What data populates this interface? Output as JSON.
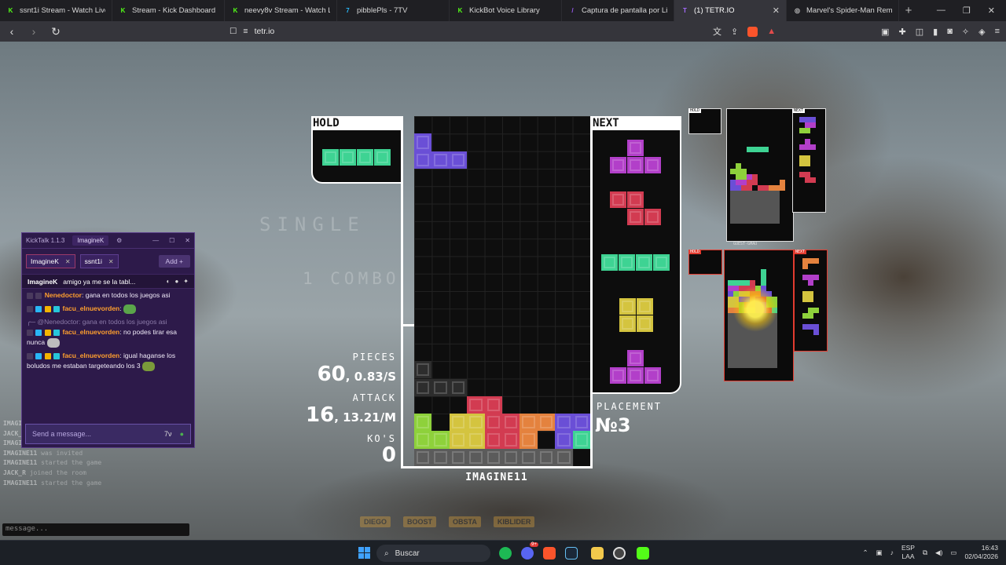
{
  "browser": {
    "tabs": [
      {
        "label": "ssnt1i Stream - Watch Live",
        "fav": "K",
        "color": "#53fc18",
        "active": false
      },
      {
        "label": "Stream - Kick Dashboard",
        "fav": "K",
        "color": "#53fc18",
        "active": false
      },
      {
        "label": "neevy8v Stream - Watch Li",
        "fav": "K",
        "color": "#53fc18",
        "active": false
      },
      {
        "label": "pibblePls - 7TV",
        "fav": "7",
        "color": "#29b6f6",
        "active": false
      },
      {
        "label": "KickBot Voice Library",
        "fav": "K",
        "color": "#53fc18",
        "active": false
      },
      {
        "label": "Captura de pantalla por Lightsh",
        "fav": "/",
        "color": "#9c5cf5",
        "active": false
      },
      {
        "label": "(1) TETR.IO",
        "fav": "T",
        "color": "#a56bff",
        "active": true
      },
      {
        "label": "Marvel's Spider-Man Remaster",
        "fav": "◎",
        "color": "#cccccc",
        "active": false
      }
    ],
    "url": "tetr.io",
    "window_controls": [
      "—",
      "❐",
      "✕"
    ]
  },
  "game": {
    "hold_label": "HOLD",
    "next_label": "NEXT",
    "ghost_clear_text": "SINGLE",
    "ghost_combo_text": "1 COMBO",
    "stats": {
      "pieces_label": "PIECES",
      "pieces_count": "60",
      "pieces_rate": ", 0.83/S",
      "attack_label": "ATTACK",
      "attack_count": "16",
      "attack_rate": ", 13.21/M",
      "kos_label": "KO'S",
      "kos_count": "0"
    },
    "placement_label": "PLACEMENT",
    "placement_value": "№3",
    "player_name": "IMAGINE11",
    "piece_colors": {
      "I": "#3ed393",
      "T": "#b23fc9",
      "Z": "#d23b51",
      "L": "#e4823e",
      "O": "#d4c43f",
      "S": "#8ed13b",
      "J": "#6a4fd6",
      "G": "#5b5b5b"
    },
    "opponent_hold_label": "HOLD",
    "opponent_next_label": "NEXT",
    "opponent2_name": "GUEST-GMAU"
  },
  "chat": {
    "app_title": "KickTalk 1.1.3",
    "user_tab": "ImagineK",
    "channel_tabs": [
      {
        "label": "ImagineK",
        "active": true
      },
      {
        "label": "ssnt1i",
        "active": false
      }
    ],
    "add_label": "Add",
    "pinned_user": "ImagineK",
    "pinned_text": "amigo ya me se la tabl...",
    "messages": [
      {
        "user": "Nenedoctor",
        "text": "gana en todos los juegos asi",
        "kind": "plain"
      },
      {
        "user": "facu_elnuevorden",
        "text": "",
        "kind": "emote"
      },
      {
        "quote": "@Nenedoctor: gana en todos los juegos asi",
        "user": "facu_elnuevorden",
        "text": "no podes tirar esa nunca",
        "kind": "reply"
      },
      {
        "user": "facu_elnuevorden",
        "text": "igual haganse los boludos me estaban targeteando los 3",
        "kind": "plain-badged"
      }
    ],
    "input_placeholder": "Send a message..."
  },
  "tetrio_chat_log": [
    {
      "user": "IMAGINE11",
      "text": "joined the room"
    },
    {
      "user": "JACK_R",
      "text": "joined the room"
    },
    {
      "user": "IMAGINE11",
      "text": "started the game"
    },
    {
      "user": "IMAGINE11",
      "text": "was invited"
    },
    {
      "user": "IMAGINE11",
      "text": "started the game"
    },
    {
      "user": "JACK_R",
      "text": "joined the room"
    },
    {
      "user": "IMAGINE11",
      "text": "started the game"
    }
  ],
  "tetrio_input_placeholder": "message...",
  "faded_badges": [
    "DIEGO",
    "BOOST",
    "OBSTA",
    "KIBLIDER"
  ],
  "taskbar": {
    "search_placeholder": "Buscar",
    "lang_top": "ESP",
    "lang_bottom": "LAA",
    "time": "16:43",
    "date": "02/04/2026",
    "notify_count": "9+"
  }
}
